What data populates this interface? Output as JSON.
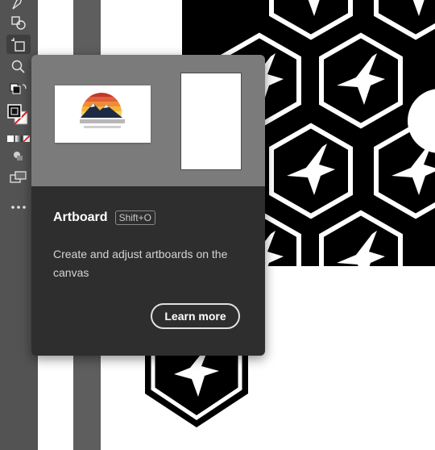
{
  "toolbar": {
    "tools": [
      {
        "name": "pen-tool-icon"
      },
      {
        "name": "shape-builder-icon"
      },
      {
        "name": "artboard-tool-icon"
      },
      {
        "name": "zoom-tool-icon"
      },
      {
        "name": "fill-stroke-swap-icon"
      },
      {
        "name": "fill-stroke-icon"
      },
      {
        "name": "color-mode-icon"
      },
      {
        "name": "draw-mode-icon"
      },
      {
        "name": "screen-mode-icon"
      },
      {
        "name": "more-tools-icon"
      }
    ]
  },
  "tooltip": {
    "title": "Artboard",
    "shortcut": "Shift+O",
    "description": "Create and adjust artboards on the canvas",
    "learn_more_label": "Learn more"
  },
  "colors": {
    "toolbar_bg": "#535353",
    "tooltip_bg": "#2e2e2e",
    "preview_bg": "#7b7b7b",
    "pattern_black": "#000000",
    "pattern_white": "#ffffff"
  }
}
